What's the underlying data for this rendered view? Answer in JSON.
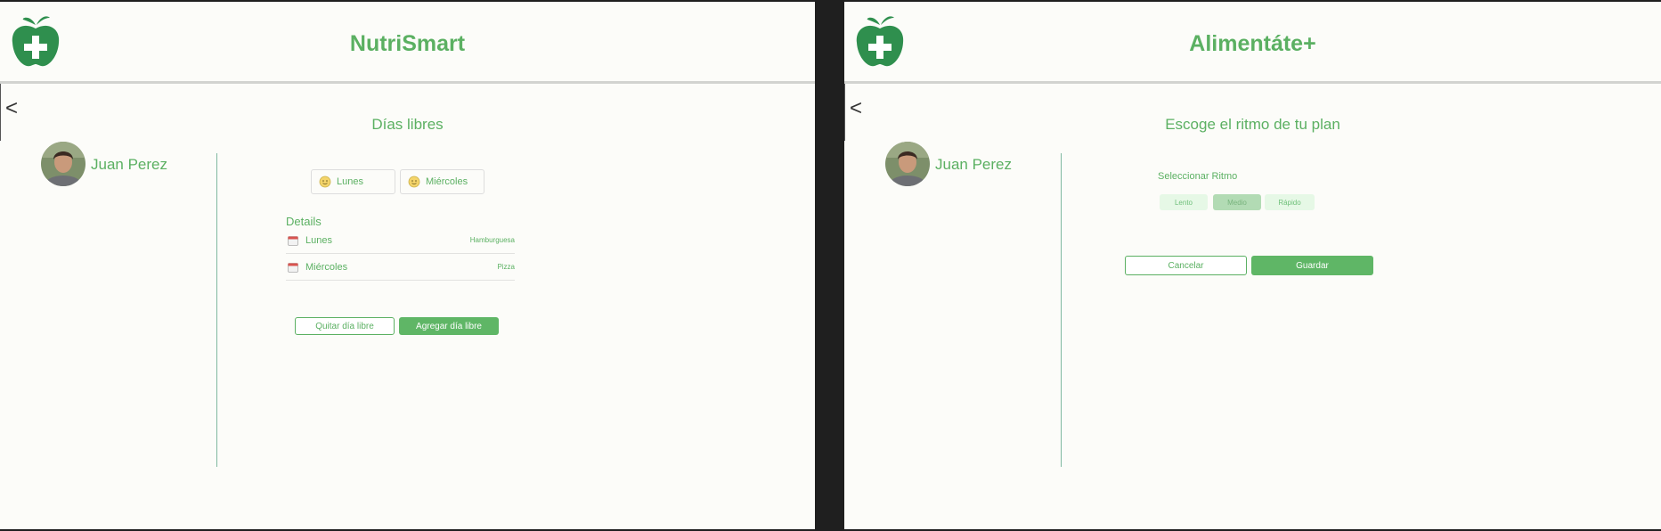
{
  "screens": [
    {
      "app_title": "NutriSmart",
      "back_glyph": "<",
      "page_title": "Días libres",
      "user_name": "Juan Perez",
      "free_days_chips": [
        {
          "label": "Lunes",
          "icon": "smiley-icon"
        },
        {
          "label": "Miércoles",
          "icon": "smiley-icon"
        }
      ],
      "details_label": "Details",
      "details": [
        {
          "day": "Lunes",
          "food": "Hamburguesa",
          "icon": "calendar-icon"
        },
        {
          "day": "Miércoles",
          "food": "Pizza",
          "icon": "calendar-icon"
        }
      ],
      "buttons": {
        "remove": "Quitar día libre",
        "add": "Agregar día libre"
      }
    },
    {
      "app_title": "Alimentáte+",
      "back_glyph": "<",
      "page_title": "Escoge el ritmo de tu plan",
      "user_name": "Juan Perez",
      "rhythm_label": "Seleccionar Ritmo",
      "rhythm_options": [
        "Lento",
        "Medio",
        "Rápido"
      ],
      "rhythm_selected": "Medio",
      "buttons": {
        "cancel": "Cancelar",
        "save": "Guardar"
      }
    }
  ],
  "colors": {
    "accent": "#5bb062",
    "logo_green": "#2f8f4e",
    "background": "#fcfcf9"
  }
}
